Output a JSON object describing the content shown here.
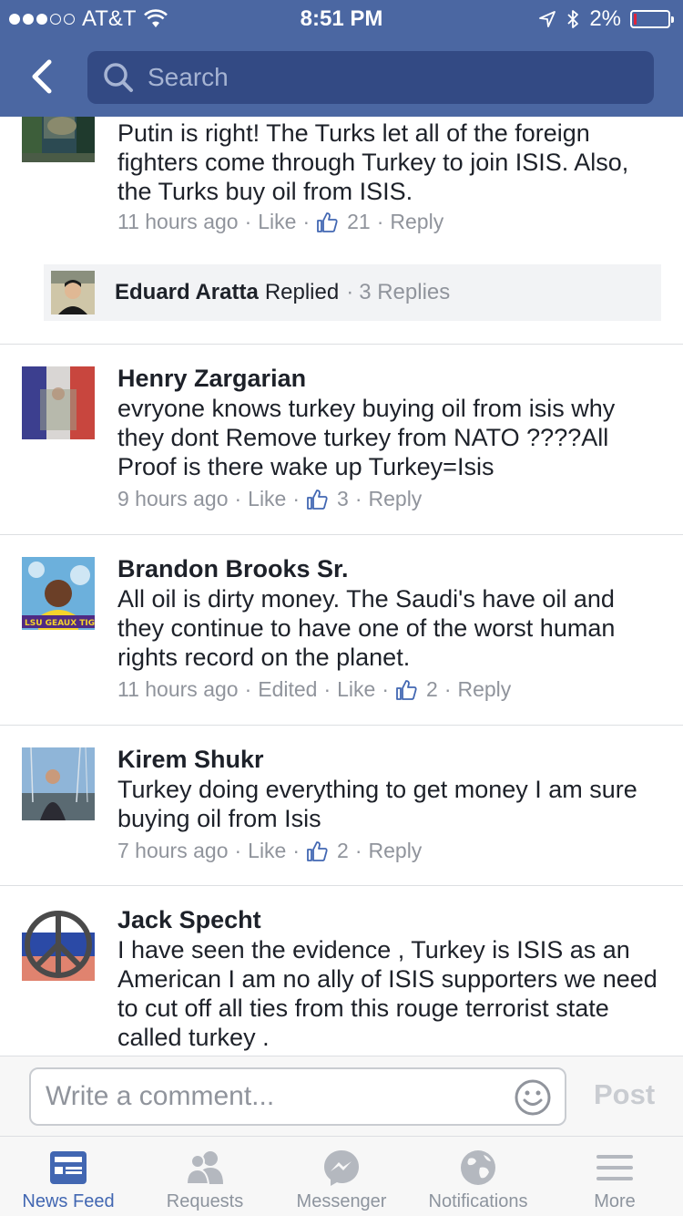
{
  "status_bar": {
    "carrier": "AT&T",
    "time": "8:51 PM",
    "battery": "2%",
    "battery_level": 0.02
  },
  "nav": {
    "search_placeholder": "Search"
  },
  "comments": [
    {
      "name": "",
      "text": "Putin is right!  The Turks let all of the foreign fighters come through Turkey to join ISIS. Also, the Turks buy oil from ISIS.",
      "time": "11 hours ago",
      "edited": "",
      "like": "Like",
      "likes": "21",
      "reply": "Reply",
      "replies_preview": {
        "name": "Eduard Aratta",
        "action": "Replied",
        "count": "3 Replies"
      }
    },
    {
      "name": "Henry Zargarian",
      "text": "evryone knows turkey buying oil from isis why they dont Remove turkey from NATO ????All Proof is there wake up Turkey=Isis",
      "time": "9 hours ago",
      "like": "Like",
      "likes": "3",
      "reply": "Reply"
    },
    {
      "name": "Brandon Brooks Sr.",
      "text": "All oil is dirty money. The Saudi's have oil and they continue to have one of  the worst human rights record on the planet.",
      "time": "11 hours ago",
      "edited": "Edited",
      "like": "Like",
      "likes": "2",
      "reply": "Reply",
      "avatar_caption": "LSU GEAUX TIGERS!"
    },
    {
      "name": "Kirem Shukr",
      "text": "Turkey doing everything to get money I am sure buying oil from Isis",
      "time": "7 hours ago",
      "like": "Like",
      "likes": "2",
      "reply": "Reply"
    },
    {
      "name": "Jack Specht",
      "text": "I have seen the evidence , Turkey is ISIS as an American I am no ally of ISIS supporters we need to cut off all ties from this rouge terrorist state called turkey ."
    }
  ],
  "composer": {
    "placeholder": "Write a comment...",
    "post_label": "Post"
  },
  "tabs": [
    {
      "label": "News Feed",
      "icon": "news-feed-icon",
      "active": true
    },
    {
      "label": "Requests",
      "icon": "requests-icon",
      "active": false
    },
    {
      "label": "Messenger",
      "icon": "messenger-icon",
      "active": false
    },
    {
      "label": "Notifications",
      "icon": "globe-icon",
      "active": false
    },
    {
      "label": "More",
      "icon": "menu-icon",
      "active": false
    }
  ],
  "colors": {
    "header": "#4b67a2",
    "search_bg": "#334a84",
    "link_blue": "#4267b2",
    "meta_gray": "#90949c"
  }
}
